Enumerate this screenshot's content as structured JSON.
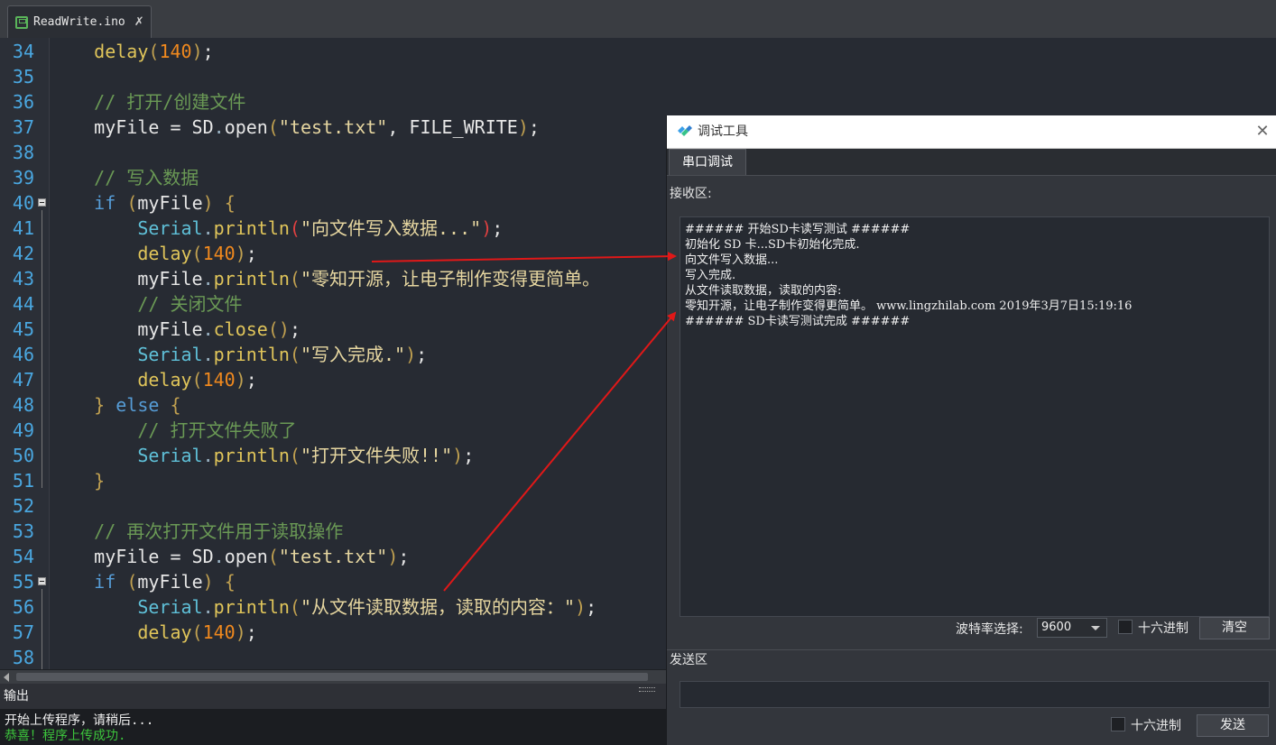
{
  "tab": {
    "filename": "ReadWrite.ino",
    "pin": "✕"
  },
  "editor": {
    "lines": [
      {
        "n": "34",
        "html": "    <span class=\"f\">delay</span><span class=\"y\">(</span><span class=\"n\">140</span><span class=\"y\">)</span><span class=\"w\">;</span>"
      },
      {
        "n": "35",
        "html": ""
      },
      {
        "n": "36",
        "html": "    <span class=\"c\">// 打开/创建文件</span>"
      },
      {
        "n": "37",
        "html": "    <span class=\"w\">myFile = </span><span class=\"w\">SD</span><span class=\"o\">.</span><span class=\"w\">open</span><span class=\"y\">(</span><span class=\"s\">\"test.txt\"</span><span class=\"w\">, FILE_WRITE</span><span class=\"y\">)</span><span class=\"w\">;</span>"
      },
      {
        "n": "38",
        "html": ""
      },
      {
        "n": "39",
        "html": "    <span class=\"c\">// 写入数据</span>"
      },
      {
        "n": "40",
        "html": "    <span class=\"k\">if</span><span class=\"w\"> </span><span class=\"y\">(</span><span class=\"w\">myFile</span><span class=\"y\">)</span><span class=\"w\"> </span><span class=\"y\">{</span>"
      },
      {
        "n": "41",
        "html": "        <span class=\"t\">Serial</span><span class=\"o\">.</span><span class=\"f\">println</span><span class=\"r\">(</span><span class=\"s\">\"向文件写入数据...\"</span><span class=\"r\">)</span><span class=\"w\">;</span>"
      },
      {
        "n": "42",
        "html": "        <span class=\"f\">delay</span><span class=\"y\">(</span><span class=\"n\">140</span><span class=\"y\">)</span><span class=\"w\">;</span>"
      },
      {
        "n": "43",
        "html": "        <span class=\"w\">myFile</span><span class=\"o\">.</span><span class=\"f\">println</span><span class=\"y\">(</span><span class=\"s\">\"零知开源，让电子制作变得更简单。</span>"
      },
      {
        "n": "44",
        "html": "        <span class=\"c\">// 关闭文件</span>"
      },
      {
        "n": "45",
        "html": "        <span class=\"w\">myFile</span><span class=\"o\">.</span><span class=\"f\">close</span><span class=\"y\">()</span><span class=\"w\">;</span>"
      },
      {
        "n": "46",
        "html": "        <span class=\"t\">Serial</span><span class=\"o\">.</span><span class=\"f\">println</span><span class=\"y\">(</span><span class=\"s\">\"写入完成.\"</span><span class=\"y\">)</span><span class=\"w\">;</span>"
      },
      {
        "n": "47",
        "html": "        <span class=\"f\">delay</span><span class=\"y\">(</span><span class=\"n\">140</span><span class=\"y\">)</span><span class=\"w\">;</span>"
      },
      {
        "n": "48",
        "html": "    <span class=\"y\">}</span><span class=\"w\"> </span><span class=\"k\">else</span><span class=\"w\"> </span><span class=\"y\">{</span>"
      },
      {
        "n": "49",
        "html": "        <span class=\"c\">// 打开文件失败了</span>"
      },
      {
        "n": "50",
        "html": "        <span class=\"t\">Serial</span><span class=\"o\">.</span><span class=\"f\">println</span><span class=\"y\">(</span><span class=\"s\">\"打开文件失败!!\"</span><span class=\"y\">)</span><span class=\"w\">;</span>"
      },
      {
        "n": "51",
        "html": "    <span class=\"y\">}</span>"
      },
      {
        "n": "52",
        "html": ""
      },
      {
        "n": "53",
        "html": "    <span class=\"c\">// 再次打开文件用于读取操作</span>"
      },
      {
        "n": "54",
        "html": "    <span class=\"w\">myFile = </span><span class=\"w\">SD</span><span class=\"o\">.</span><span class=\"w\">open</span><span class=\"y\">(</span><span class=\"s\">\"test.txt\"</span><span class=\"y\">)</span><span class=\"w\">;</span>"
      },
      {
        "n": "55",
        "html": "    <span class=\"k\">if</span><span class=\"w\"> </span><span class=\"y\">(</span><span class=\"w\">myFile</span><span class=\"y\">)</span><span class=\"w\"> </span><span class=\"y\">{</span>"
      },
      {
        "n": "56",
        "html": "        <span class=\"t\">Serial</span><span class=\"o\">.</span><span class=\"f\">println</span><span class=\"y\">(</span><span class=\"s\">\"从文件读取数据，读取的内容：\"</span><span class=\"y\">)</span><span class=\"w\">;</span>"
      },
      {
        "n": "57",
        "html": "        <span class=\"f\">delay</span><span class=\"y\">(</span><span class=\"n\">140</span><span class=\"y\">)</span><span class=\"w\">;</span>"
      },
      {
        "n": "58",
        "html": ""
      }
    ]
  },
  "output": {
    "title": "输出",
    "lines": [
      {
        "text": "开始上传程序，请稍后...",
        "color": "#f0f0f0"
      },
      {
        "text": "恭喜！程序上传成功.",
        "color": "#3cc43c"
      }
    ]
  },
  "tool": {
    "title": "调试工具",
    "close": "✕",
    "tab": "串口调试",
    "recv_label": "接收区:",
    "recv_lines": [
      "###### 开始SD卡读写测试 ######",
      "初始化 SD 卡...SD卡初始化完成.",
      "向文件写入数据...",
      "写入完成.",
      "从文件读取数据，读取的内容:",
      "零知开源，让电子制作变得更简单。 www.lingzhilab.com 2019年3月7日15:19:16",
      "###### SD卡读写测试完成 ######"
    ],
    "baud_label": "波特率选择:",
    "baud_value": "9600",
    "hex_label": "十六进制",
    "clear_label": "清空",
    "send_label": "发送区",
    "send_hex_label": "十六进制",
    "send_button": "发送"
  },
  "colors": {
    "arrow": "#e01818",
    "success": "#3cc43c"
  }
}
